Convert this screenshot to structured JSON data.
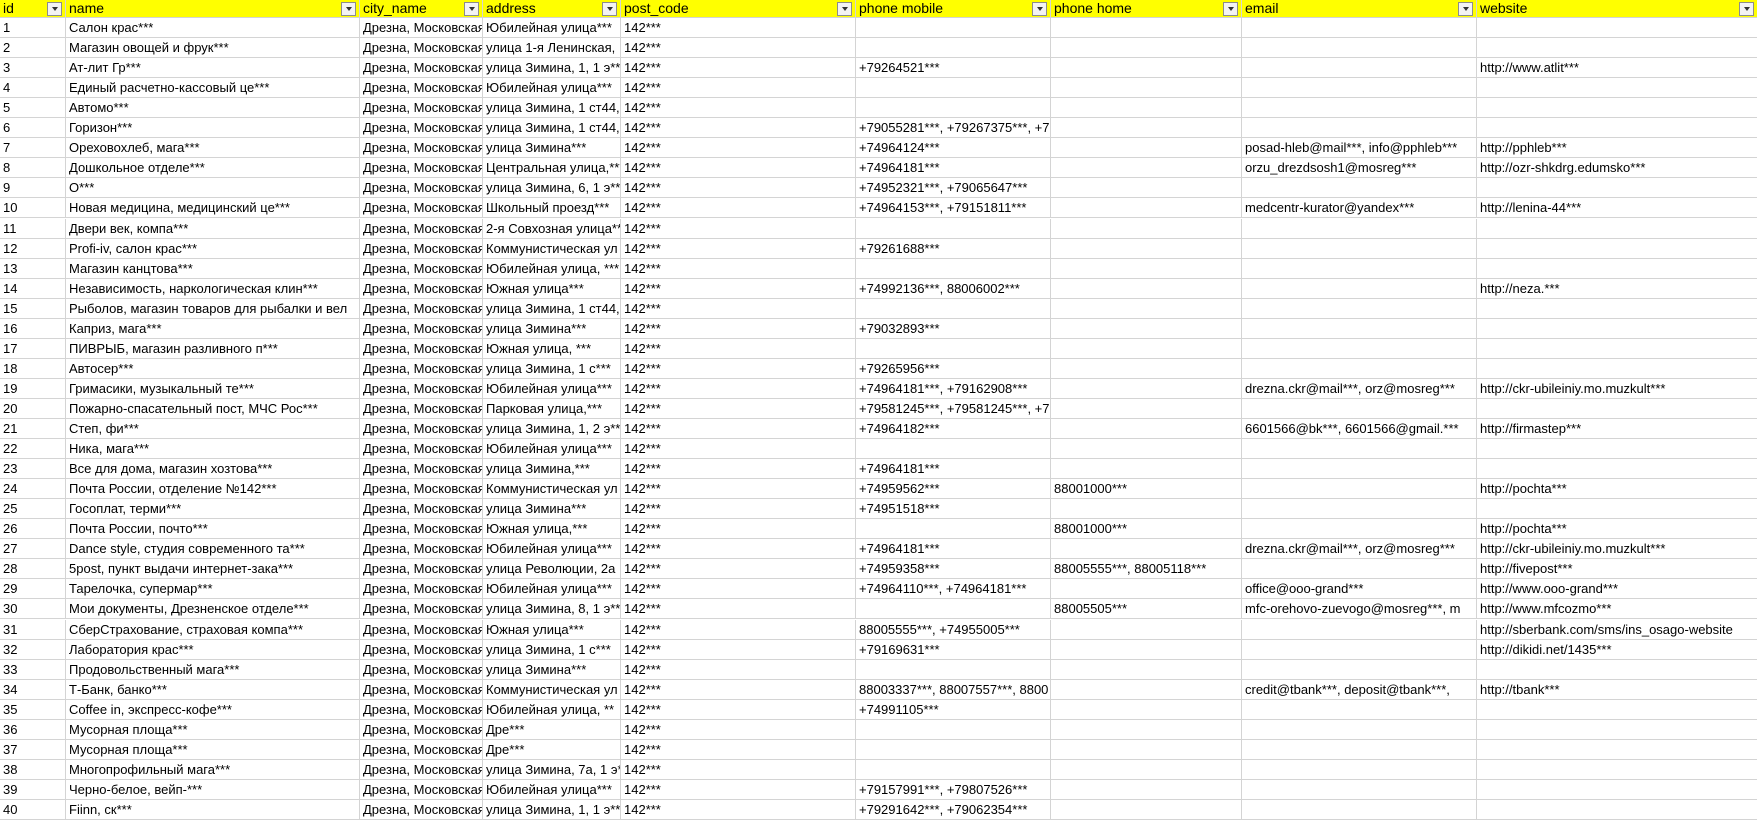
{
  "headers": [
    "id",
    "name",
    "city_name",
    "address",
    "post_code",
    "phone mobile",
    "phone home",
    "email",
    "website"
  ],
  "filter_icon": "dropdown-arrow-icon",
  "colors": {
    "header_bg": "#ffff00",
    "grid": "#d4d4d4"
  },
  "rows": [
    [
      "1",
      "Салон крас***",
      "Дрезна, Московская",
      "Юбилейная улица***",
      "142***",
      "",
      "",
      "",
      ""
    ],
    [
      "2",
      "Магазин овощей и фрук***",
      "Дрезна, Московская",
      "улица 1-я Ленинская,",
      "142***",
      "",
      "",
      "",
      ""
    ],
    [
      "3",
      "Ат-лит Гр***",
      "Дрезна, Московская",
      "улица Зимина, 1, 1 э***",
      "142***",
      "+79264521***",
      "",
      "",
      "http://www.atlit***"
    ],
    [
      "4",
      "Единый расчетно-кассовый це***",
      "Дрезна, Московская",
      "Юбилейная улица***",
      "142***",
      "",
      "",
      "",
      ""
    ],
    [
      "5",
      "Автомо***",
      "Дрезна, Московская",
      "улица Зимина, 1 ст44,",
      "142***",
      "",
      "",
      "",
      ""
    ],
    [
      "6",
      "Горизон***",
      "Дрезна, Московская",
      "улица Зимина, 1 ст44,",
      "142***",
      "+79055281***, +79267375***, +7",
      "",
      "",
      ""
    ],
    [
      "7",
      "Ореховохлеб, мага***",
      "Дрезна, Московская",
      "улица Зимина***",
      "142***",
      "+74964124***",
      "",
      "posad-hleb@mail***, info@pphleb***",
      "http://pphleb***"
    ],
    [
      "8",
      "Дошкольное отделе***",
      "Дрезна, Московская",
      "Центральная улица,***",
      "142***",
      "+74964181***",
      "",
      "orzu_drezdsosh1@mosreg***",
      "http://ozr-shkdrg.edumsko***"
    ],
    [
      "9",
      "О***",
      "Дрезна, Московская",
      "улица Зимина, 6, 1 э***",
      "142***",
      "+74952321***, +79065647***",
      "",
      "",
      ""
    ],
    [
      "10",
      "Новая медицина, медицинский це***",
      "Дрезна, Московская",
      "Школьный проезд***",
      "142***",
      "+74964153***, +79151811***",
      "",
      "medcentr-kurator@yandex***",
      "http://lenina-44***"
    ],
    [
      "11",
      "Двери век, компа***",
      "Дрезна, Московская",
      "2-я Совхозная улица***",
      "142***",
      "",
      "",
      "",
      ""
    ],
    [
      "12",
      "Profi-iv, салон крас***",
      "Дрезна, Московская",
      "Коммунистическая ул",
      "142***",
      "+79261688***",
      "",
      "",
      ""
    ],
    [
      "13",
      "Магазин канцтова***",
      "Дрезна, Московская",
      "Юбилейная улица, ***",
      "142***",
      "",
      "",
      "",
      ""
    ],
    [
      "14",
      "Независимость, наркологическая клин***",
      "Дрезна, Московская",
      "Южная улица***",
      "142***",
      "+74992136***, 88006002***",
      "",
      "",
      "http://neza.***"
    ],
    [
      "15",
      "Рыболов, магазин товаров для рыбалки и вел",
      "Дрезна, Московская",
      "улица Зимина, 1 ст44,",
      "142***",
      "",
      "",
      "",
      ""
    ],
    [
      "16",
      "Каприз, мага***",
      "Дрезна, Московская",
      "улица Зимина***",
      "142***",
      "+79032893***",
      "",
      "",
      ""
    ],
    [
      "17",
      "ПИВРЫБ, магазин разливного п***",
      "Дрезна, Московская",
      "Южная улица, ***",
      "142***",
      "",
      "",
      "",
      ""
    ],
    [
      "18",
      "Автосер***",
      "Дрезна, Московская",
      "улица Зимина, 1 с***",
      "142***",
      "+79265956***",
      "",
      "",
      ""
    ],
    [
      "19",
      "Гримасики, музыкальный те***",
      "Дрезна, Московская",
      "Юбилейная улица***",
      "142***",
      "+74964181***, +79162908***",
      "",
      "drezna.ckr@mail***, orz@mosreg***",
      "http://ckr-ubileiniy.mo.muzkult***"
    ],
    [
      "20",
      "Пожарно-спасательный пост, МЧС Рос***",
      "Дрезна, Московская",
      "Парковая улица,***",
      "142***",
      "+79581245***, +79581245***, +7",
      "",
      "",
      ""
    ],
    [
      "21",
      "Степ, фи***",
      "Дрезна, Московская",
      "улица Зимина, 1, 2 э***",
      "142***",
      "+74964182***",
      "",
      "6601566@bk***, 6601566@gmail.***",
      "http://firmastep***"
    ],
    [
      "22",
      "Ника, мага***",
      "Дрезна, Московская",
      "Юбилейная улица***",
      "142***",
      "",
      "",
      "",
      ""
    ],
    [
      "23",
      "Все для дома, магазин хозтова***",
      "Дрезна, Московская",
      "улица Зимина,***",
      "142***",
      "+74964181***",
      "",
      "",
      ""
    ],
    [
      "24",
      "Почта России, отделение №142***",
      "Дрезна, Московская",
      "Коммунистическая ул",
      "142***",
      "+74959562***",
      "88001000***",
      "",
      "http://pochta***"
    ],
    [
      "25",
      "Госоплат, терми***",
      "Дрезна, Московская",
      "улица Зимина***",
      "142***",
      "+74951518***",
      "",
      "",
      ""
    ],
    [
      "26",
      "Почта России, почто***",
      "Дрезна, Московская",
      "Южная улица,***",
      "142***",
      "",
      "88001000***",
      "",
      "http://pochta***"
    ],
    [
      "27",
      "Dance style, студия современного та***",
      "Дрезна, Московская",
      "Юбилейная улица***",
      "142***",
      "+74964181***",
      "",
      "drezna.ckr@mail***, orz@mosreg***",
      "http://ckr-ubileiniy.mo.muzkult***"
    ],
    [
      "28",
      "5post, пункт выдачи интернет-зака***",
      "Дрезна, Московская",
      "улица Революции, 2а",
      "142***",
      "+74959358***",
      "88005555***, 88005118***",
      "",
      "http://fivepost***"
    ],
    [
      "29",
      "Тарелочка, супермар***",
      "Дрезна, Московская",
      "Юбилейная улица***",
      "142***",
      "+74964110***, +74964181***",
      "",
      "office@ooo-grand***",
      "http://www.ooo-grand***"
    ],
    [
      "30",
      "Мои документы, Дрезненское отделе***",
      "Дрезна, Московская",
      "улица Зимина, 8, 1 э***",
      "142***",
      "",
      "88005505***",
      "mfc-orehovo-zuevogo@mosreg***, m",
      "http://www.mfcozmo***"
    ],
    [
      "31",
      "СберСтрахование, страховая компа***",
      "Дрезна, Московская",
      "Южная улица***",
      "142***",
      "88005555***, +74955005***",
      "",
      "",
      "http://sberbank.com/sms/ins_osago-website"
    ],
    [
      "32",
      "Лаборатория крас***",
      "Дрезна, Московская",
      "улица Зимина, 1 с***",
      "142***",
      "+79169631***",
      "",
      "",
      "http://dikidi.net/1435***"
    ],
    [
      "33",
      "Продовольственный мага***",
      "Дрезна, Московская",
      "улица Зимина***",
      "142***",
      "",
      "",
      "",
      ""
    ],
    [
      "34",
      "Т-Банк, банко***",
      "Дрезна, Московская",
      "Коммунистическая ул",
      "142***",
      "88003337***, 88007557***, 8800",
      "",
      "credit@tbank***, deposit@tbank***,",
      "http://tbank***"
    ],
    [
      "35",
      "Coffee in, экспресс-кофе***",
      "Дрезна, Московская",
      "Юбилейная улица, **",
      "142***",
      "+74991105***",
      "",
      "",
      ""
    ],
    [
      "36",
      "Мусорная площа***",
      "Дрезна, Московская",
      "Дре***",
      "142***",
      "",
      "",
      "",
      ""
    ],
    [
      "37",
      "Мусорная площа***",
      "Дрезна, Московская",
      "Дре***",
      "142***",
      "",
      "",
      "",
      ""
    ],
    [
      "38",
      "Многопрофильный мага***",
      "Дрезна, Московская",
      "улица Зимина, 7а, 1 э***",
      "142***",
      "",
      "",
      "",
      ""
    ],
    [
      "39",
      "Черно-белое, вейп-***",
      "Дрезна, Московская",
      "Юбилейная улица***",
      "142***",
      "+79157991***, +79807526***",
      "",
      "",
      ""
    ],
    [
      "40",
      "Fiinn, ск***",
      "Дрезна, Московская",
      "улица Зимина, 1, 1 э***",
      "142***",
      "+79291642***, +79062354***",
      "",
      "",
      ""
    ]
  ]
}
